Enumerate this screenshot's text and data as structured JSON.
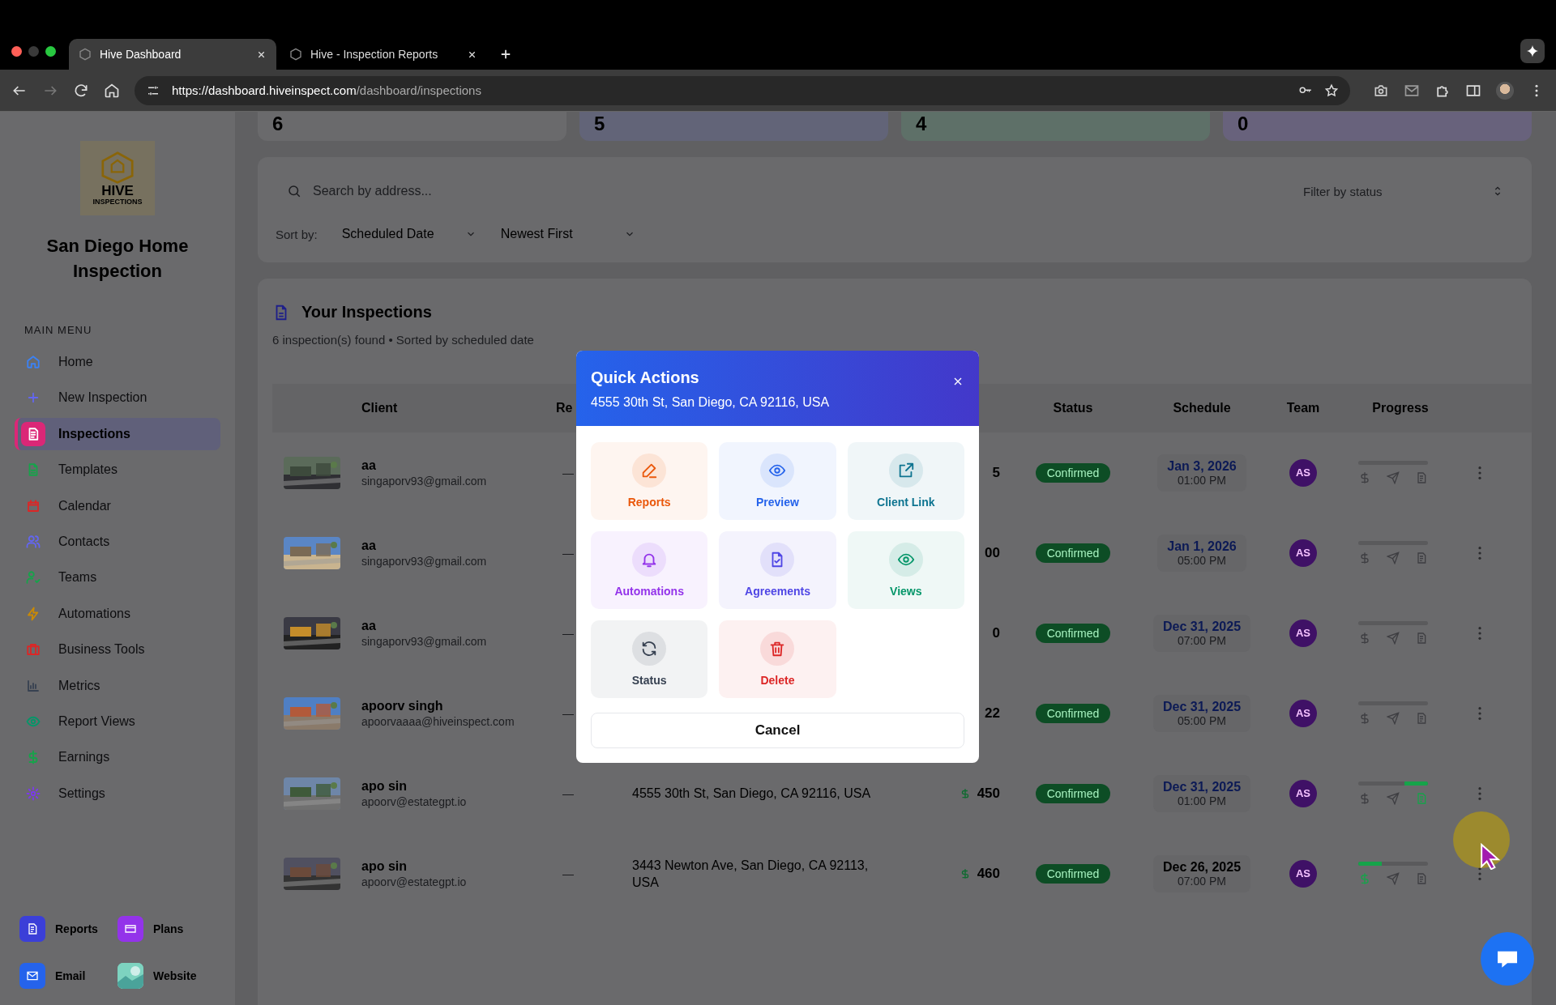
{
  "browser": {
    "tabs": [
      {
        "title": "Hive Dashboard",
        "selected": true
      },
      {
        "title": "Hive - Inspection Reports",
        "selected": false
      }
    ],
    "url": {
      "host": "https://dashboard.hiveinspect.com",
      "path": "/dashboard/inspections"
    }
  },
  "sidebar": {
    "logo": {
      "word": "HIVE",
      "sub": "INSPECTIONS"
    },
    "company": "San Diego Home Inspection",
    "section": "MAIN MENU",
    "items": [
      {
        "label": "Home",
        "kind": "home",
        "color": "#3b82f6",
        "selected": false
      },
      {
        "label": "New Inspection",
        "kind": "plus",
        "color": "#6366f1",
        "selected": false
      },
      {
        "label": "Inspections",
        "kind": "doc",
        "color": "#db2777",
        "selected": true
      },
      {
        "label": "Templates",
        "kind": "file",
        "color": "#16a34a",
        "selected": false
      },
      {
        "label": "Calendar",
        "kind": "calendar",
        "color": "#dc2626",
        "selected": false
      },
      {
        "label": "Contacts",
        "kind": "users",
        "color": "#6366f1",
        "selected": false
      },
      {
        "label": "Teams",
        "kind": "usercheck",
        "color": "#16a34a",
        "selected": false
      },
      {
        "label": "Automations",
        "kind": "bolt",
        "color": "#ca8a04",
        "selected": false
      },
      {
        "label": "Business Tools",
        "kind": "briefcase",
        "color": "#dc2626",
        "selected": false
      },
      {
        "label": "Metrics",
        "kind": "chart",
        "color": "#374151",
        "selected": false
      },
      {
        "label": "Report Views",
        "kind": "eye",
        "color": "#059669",
        "selected": false
      },
      {
        "label": "Earnings",
        "kind": "dollar",
        "color": "#16a34a",
        "selected": false
      },
      {
        "label": "Settings",
        "kind": "gear",
        "color": "#7c3aed",
        "selected": false
      }
    ],
    "shortcuts": [
      {
        "label": "Reports",
        "kind": "doc",
        "color": "#3b3fd8"
      },
      {
        "label": "Plans",
        "kind": "card",
        "color": "#9333ea"
      },
      {
        "label": "Email",
        "kind": "mail",
        "color": "#2563eb"
      },
      {
        "label": "Website",
        "kind": "picture",
        "color": "#7dd3c0"
      }
    ]
  },
  "stats": [
    {
      "value": "6",
      "color": "#6a6a6c"
    },
    {
      "value": "5",
      "color": "#626478"
    },
    {
      "value": "4",
      "color": "#5e7068"
    },
    {
      "value": "0",
      "color": "#68627c"
    }
  ],
  "filters": {
    "search_placeholder": "Search by address...",
    "status_placeholder": "Filter by status",
    "sort_label": "Sort by:",
    "sort_field": "Scheduled Date",
    "sort_order": "Newest First"
  },
  "inspections": {
    "title": "Your Inspections",
    "subtitle": "6 inspection(s) found • Sorted by scheduled date",
    "columns": [
      "Client",
      "Re",
      "Status",
      "Schedule",
      "Team",
      "Progress"
    ],
    "rows": [
      {
        "client": "aa",
        "email": "singaporv93@gmail.com",
        "re": "—",
        "price": "5",
        "dollar_icon": false,
        "status": "Confirmed",
        "date": "Jan 3, 2026",
        "time": "01:00 PM",
        "upcoming": true,
        "team": "AS",
        "steps": [
          false,
          false,
          false
        ]
      },
      {
        "client": "aa",
        "email": "singaporv93@gmail.com",
        "re": "—",
        "price": "00",
        "dollar_icon": false,
        "status": "Confirmed",
        "date": "Jan 1, 2026",
        "time": "05:00 PM",
        "upcoming": true,
        "team": "AS",
        "steps": [
          false,
          false,
          false
        ]
      },
      {
        "client": "aa",
        "email": "singaporv93@gmail.com",
        "re": "—",
        "price": "0",
        "dollar_icon": false,
        "status": "Confirmed",
        "date": "Dec 31, 2025",
        "time": "07:00 PM",
        "upcoming": true,
        "team": "AS",
        "steps": [
          false,
          false,
          false
        ]
      },
      {
        "client": "apoorv singh",
        "email": "apoorvaaaa@hiveinspect.com",
        "re": "—",
        "price": "22",
        "dollar_icon": false,
        "status": "Confirmed",
        "date": "Dec 31, 2025",
        "time": "05:00 PM",
        "upcoming": true,
        "team": "AS",
        "steps": [
          false,
          false,
          false
        ]
      },
      {
        "client": "apo sin",
        "email": "apoorv@estategpt.io",
        "re": "—",
        "address": "4555 30th St, San Diego, CA 92116, USA",
        "price": "450",
        "dollar_icon": true,
        "status": "Confirmed",
        "date": "Dec 31, 2025",
        "time": "01:00 PM",
        "upcoming": true,
        "team": "AS",
        "steps": [
          false,
          false,
          true
        ]
      },
      {
        "client": "apo sin",
        "email": "apoorv@estategpt.io",
        "re": "—",
        "address": "3443 Newton Ave, San Diego, CA 92113, USA",
        "price": "460",
        "dollar_icon": true,
        "status": "Confirmed",
        "date": "Dec 26, 2025",
        "time": "07:00 PM",
        "upcoming": false,
        "team": "AS",
        "steps": [
          true,
          false,
          false
        ]
      }
    ]
  },
  "modal": {
    "title": "Quick Actions",
    "address": "4555 30th St, San Diego, CA 92116, USA",
    "actions": [
      {
        "label": "Reports",
        "kind": "edit",
        "color": "#ea580c"
      },
      {
        "label": "Preview",
        "kind": "eye",
        "color": "#2563eb"
      },
      {
        "label": "Client Link",
        "kind": "link",
        "color": "#0e7490"
      },
      {
        "label": "Automations",
        "kind": "bell",
        "color": "#9333ea"
      },
      {
        "label": "Agreements",
        "kind": "filecheck",
        "color": "#4f46e5"
      },
      {
        "label": "Views",
        "kind": "eye",
        "color": "#059669"
      },
      {
        "label": "Status",
        "kind": "refresh",
        "color": "#374151"
      },
      {
        "label": "Delete",
        "kind": "trash",
        "color": "#dc2626"
      }
    ],
    "cancel": "Cancel"
  }
}
